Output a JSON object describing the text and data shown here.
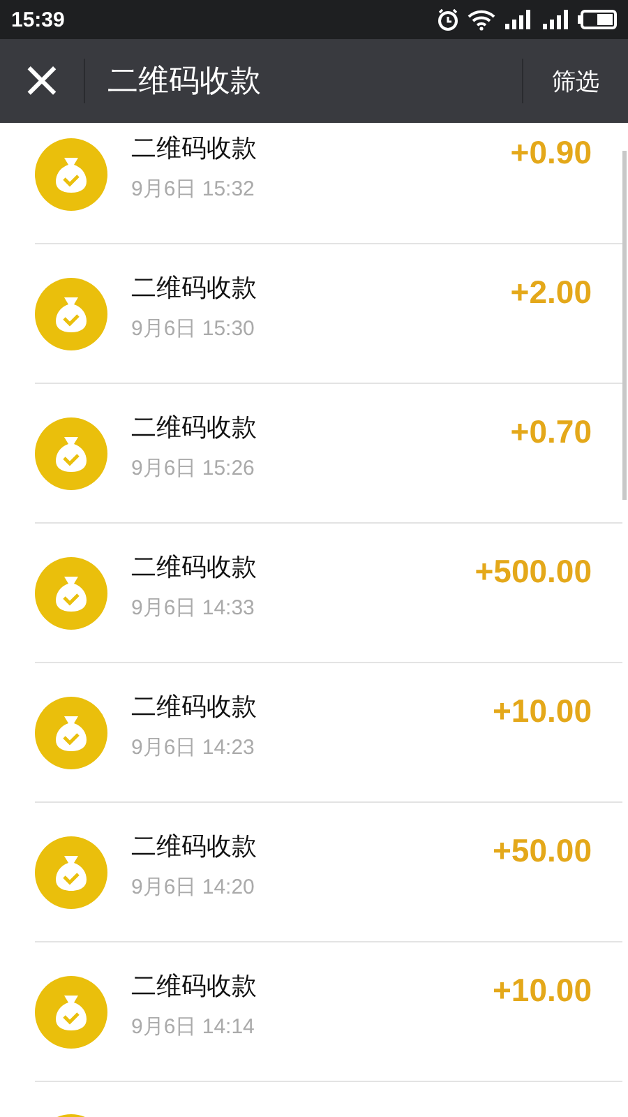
{
  "status_bar": {
    "time": "15:39"
  },
  "title_bar": {
    "close": "×",
    "title": "二维码收款",
    "action": "筛选"
  },
  "records": [
    {
      "kind": "record",
      "title": "二维码收款",
      "date": "9月6日 15:32",
      "amount": "+0.90"
    },
    {
      "kind": "record",
      "title": "二维码收款",
      "date": "9月6日 15:30",
      "amount": "+2.00"
    },
    {
      "kind": "record",
      "title": "二维码收款",
      "date": "9月6日 15:26",
      "amount": "+0.70"
    },
    {
      "kind": "record",
      "title": "二维码收款",
      "date": "9月6日 14:33",
      "amount": "+500.00"
    },
    {
      "kind": "record",
      "title": "二维码收款",
      "date": "9月6日 14:23",
      "amount": "+10.00"
    },
    {
      "kind": "record",
      "title": "二维码收款",
      "date": "9月6日 14:20",
      "amount": "+50.00"
    },
    {
      "kind": "record",
      "title": "二维码收款",
      "date": "9月6日 14:14",
      "amount": "+10.00"
    },
    {
      "kind": "cut"
    }
  ]
}
